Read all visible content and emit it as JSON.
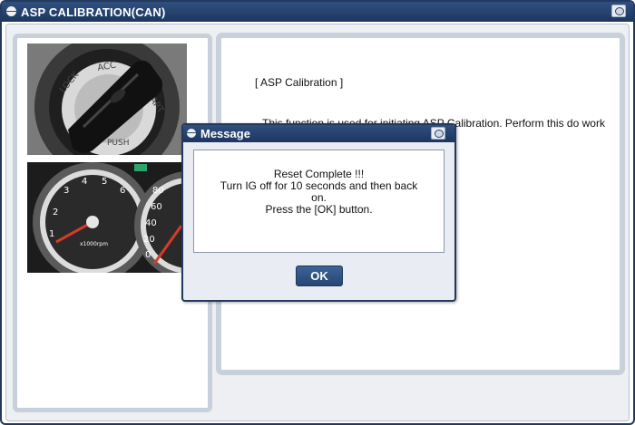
{
  "window": {
    "title": "ASP CALIBRATION(CAN)"
  },
  "description": {
    "heading": "[ ASP Calibration ]",
    "text": "This function is used for initiating ASP Calibration. Perform this do work related to EPS."
  },
  "dialog": {
    "title": "Message",
    "lines": [
      "Reset Complete !!!",
      "Turn IG off for 10 seconds and then back",
      "on.",
      "Press the [OK] button."
    ],
    "ok_label": "OK"
  },
  "images": {
    "ignition_key_photo": "ignition-key-photo",
    "instrument_cluster_photo": "instrument-cluster-photo"
  },
  "colors": {
    "titlebar": "#23395e",
    "panel_border": "#c8d0dc",
    "button": "#2f5288"
  }
}
